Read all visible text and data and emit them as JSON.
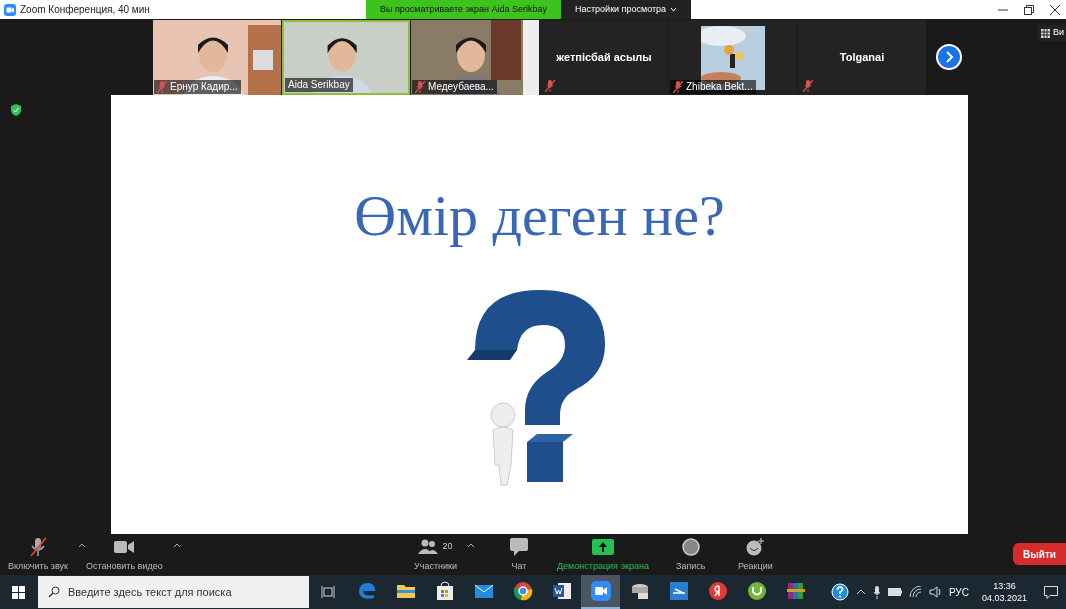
{
  "window": {
    "title": "Zoom Конференция, 40 мин"
  },
  "banner": {
    "text": "Вы просматриваете экран Aida Serikbay",
    "view_settings": "Настройки просмотра"
  },
  "view_button": {
    "label": "Ви"
  },
  "participants": [
    {
      "kind": "video",
      "name": "Ернур Кадир...",
      "muted": true,
      "active_speaker": false
    },
    {
      "kind": "video",
      "name": "Aida Serikbay",
      "muted": false,
      "active_speaker": true
    },
    {
      "kind": "video",
      "name": "Медеубаева...",
      "muted": true,
      "active_speaker": false
    },
    {
      "kind": "name",
      "name": "жетпісбай асылы",
      "muted": true,
      "active_speaker": false
    },
    {
      "kind": "video",
      "name": "Zhibeka Bekt...",
      "muted": true,
      "active_speaker": false
    },
    {
      "kind": "name",
      "name": "Tolganai",
      "muted": true,
      "active_speaker": false
    }
  ],
  "slide": {
    "title": "Өмір деген не?"
  },
  "toolbar": [
    {
      "kind": "mic",
      "label": "Включить звук",
      "muted": true
    },
    {
      "kind": "video",
      "label": "Остановить видео"
    },
    {
      "kind": "participants",
      "label": "Участники",
      "count": "20"
    },
    {
      "kind": "chat",
      "label": "Чат"
    },
    {
      "kind": "share",
      "label": "Демонстрация экрана"
    },
    {
      "kind": "record",
      "label": "Запись"
    },
    {
      "kind": "reactions",
      "label": "Реакции"
    }
  ],
  "leave_button": "Выйти",
  "taskbar": {
    "search_placeholder": "Введите здесь текст для поиска",
    "language": "РУС",
    "time": "13:36",
    "date": "04.03.2021",
    "apps": [
      {
        "kind": "edge",
        "selected": false
      },
      {
        "kind": "folder",
        "selected": false
      },
      {
        "kind": "store",
        "selected": false
      },
      {
        "kind": "mail",
        "selected": false
      },
      {
        "kind": "chrome",
        "selected": false
      },
      {
        "kind": "word",
        "selected": false
      },
      {
        "kind": "zoom",
        "selected": true
      },
      {
        "kind": "drive",
        "selected": false
      },
      {
        "kind": "scanner",
        "selected": false
      },
      {
        "kind": "yandex",
        "selected": false
      },
      {
        "kind": "torrent",
        "selected": false
      },
      {
        "kind": "archive",
        "selected": false
      }
    ]
  }
}
